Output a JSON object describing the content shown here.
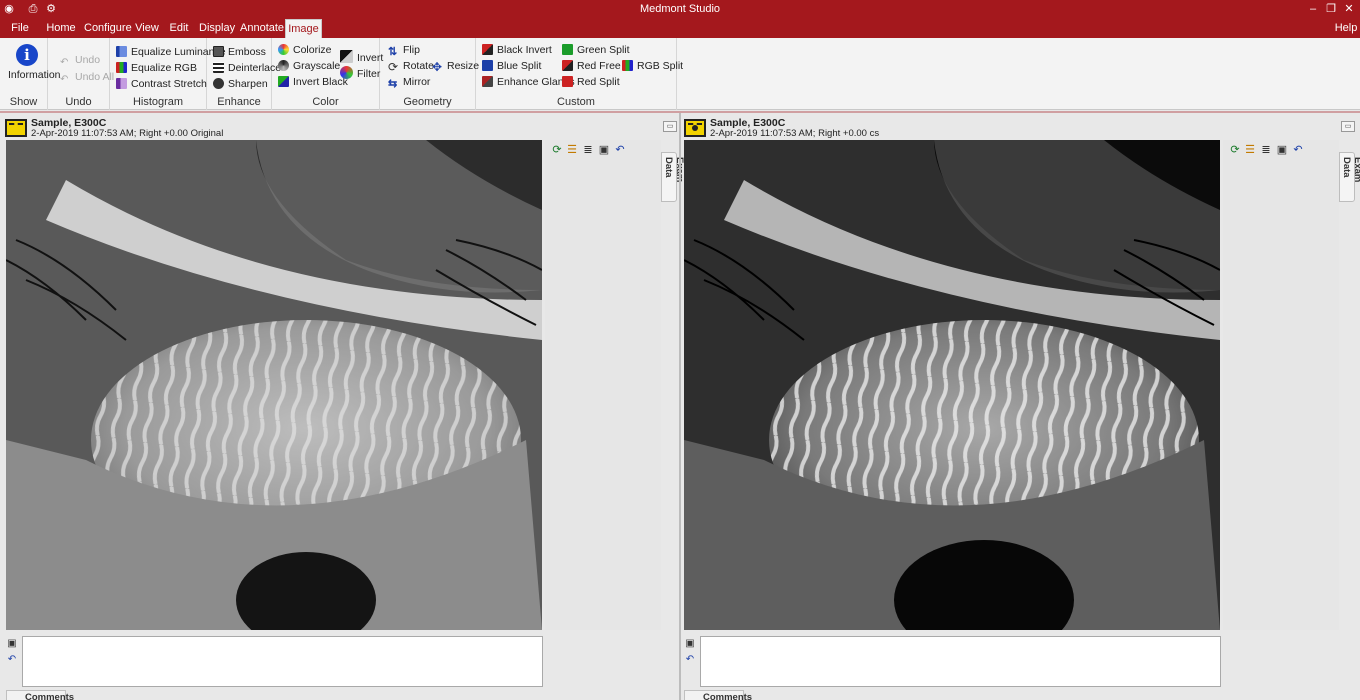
{
  "app": {
    "title": "Medmont Studio"
  },
  "menu": {
    "tabs": [
      "File",
      "Home",
      "Configure",
      "View",
      "Edit",
      "Display",
      "Annotate",
      "Image"
    ],
    "active": "Image",
    "help": "Help"
  },
  "ribbon": {
    "show": {
      "label": "Show",
      "information": "Information"
    },
    "undo": {
      "label": "Undo",
      "undo": "Undo",
      "undo_all": "Undo All"
    },
    "histogram": {
      "label": "Histogram",
      "equalize_luminance": "Equalize Luminance",
      "equalize_rgb": "Equalize RGB",
      "contrast_stretch": "Contrast Stretch"
    },
    "enhance": {
      "label": "Enhance",
      "emboss": "Emboss",
      "deinterlace": "Deinterlace",
      "sharpen": "Sharpen"
    },
    "color": {
      "label": "Color",
      "colorize": "Colorize",
      "grayscale": "Grayscale",
      "invert_black": "Invert Black",
      "invert": "Invert",
      "filter": "Filter"
    },
    "geometry": {
      "label": "Geometry",
      "flip": "Flip",
      "rotate": "Rotate",
      "mirror": "Mirror",
      "resize": "Resize"
    },
    "custom": {
      "label": "Custom",
      "black_invert": "Black Invert",
      "blue_split": "Blue Split",
      "enhance_glands": "Enhance Glands",
      "green_split": "Green Split",
      "red_free": "Red Free",
      "red_split": "Red Split",
      "rgb_split": "RGB Split"
    }
  },
  "panes": [
    {
      "title": "Sample, E300C",
      "subtitle": "2-Apr-2019 11:07:53 AM; Right +0.00 Original",
      "side_tab": "Exam Data",
      "comments_tab": "Comments"
    },
    {
      "title": "Sample, E300C",
      "subtitle": "2-Apr-2019 11:07:53 AM; Right +0.00 cs",
      "side_tab": "Exam Data",
      "comments_tab": "Comments"
    }
  ],
  "colors": {
    "brand": "#a4181d",
    "ribbon_bg": "#f3f3f3",
    "info_blue": "#1846c9",
    "camera_yellow": "#f2d300"
  }
}
